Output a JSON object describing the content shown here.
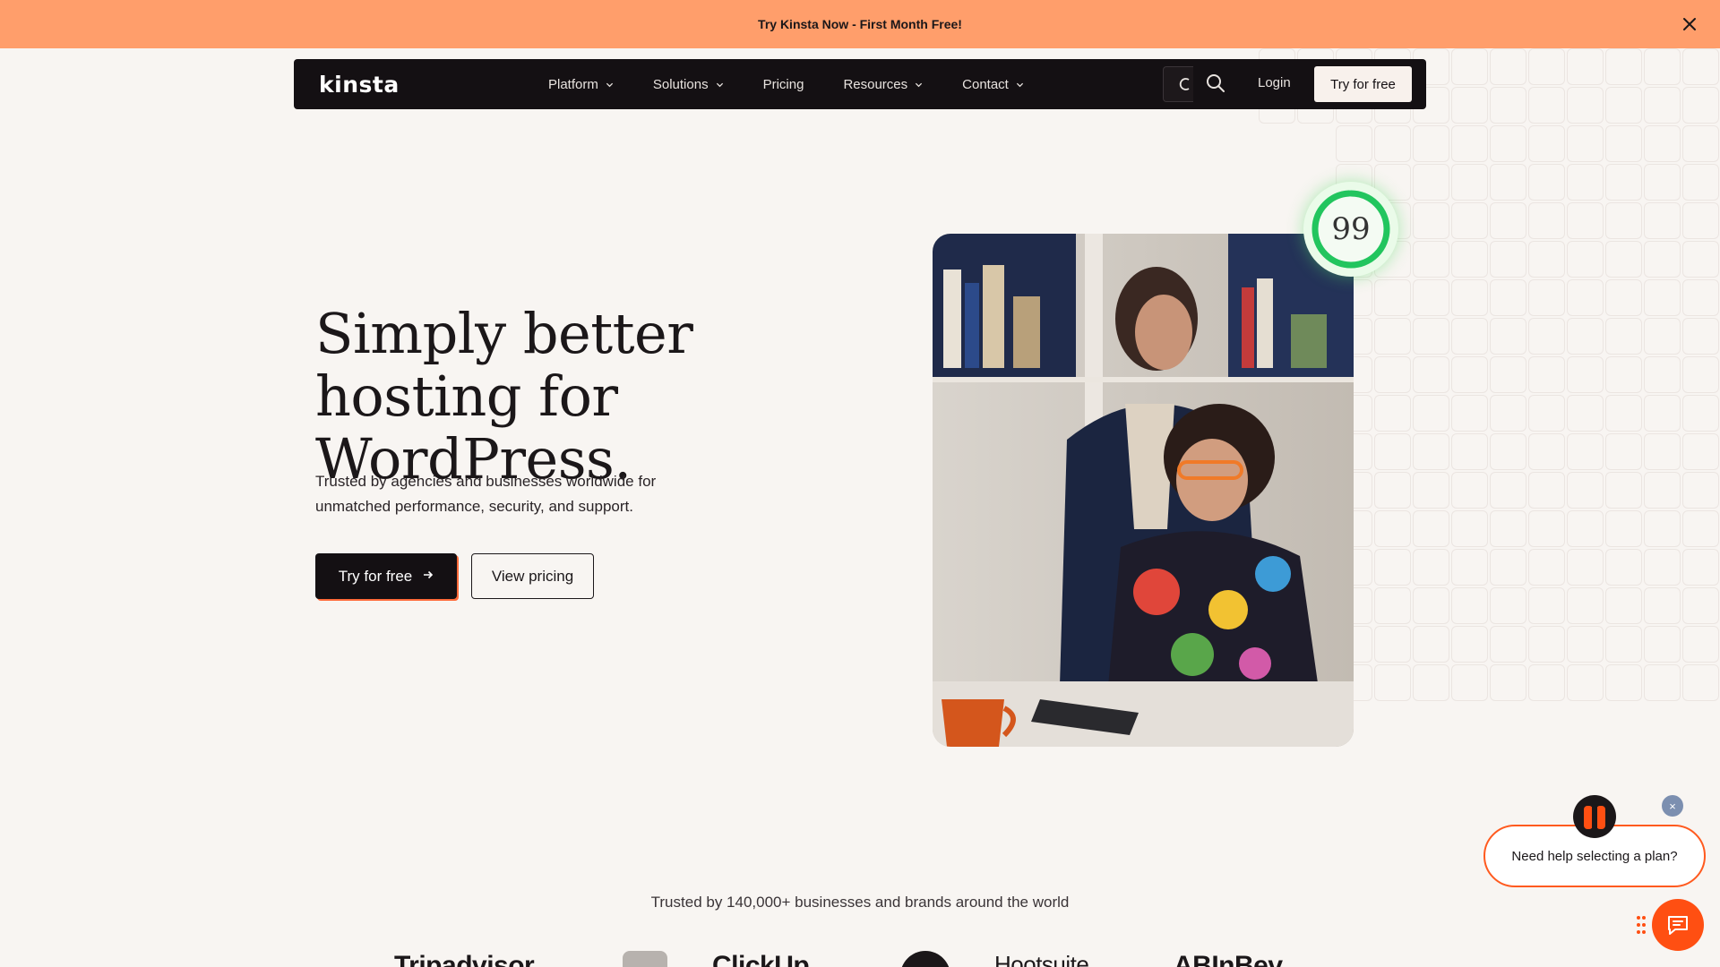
{
  "announcement": {
    "text": "Try Kinsta Now - First Month Free!",
    "close_icon": "close-icon"
  },
  "nav": {
    "logo": "kinsta",
    "items": [
      {
        "label": "Platform",
        "has_dropdown": true
      },
      {
        "label": "Solutions",
        "has_dropdown": true
      },
      {
        "label": "Pricing",
        "has_dropdown": false
      },
      {
        "label": "Resources",
        "has_dropdown": true
      },
      {
        "label": "Contact",
        "has_dropdown": true
      }
    ],
    "login": "Login",
    "cta": "Try for free",
    "search_icon": "search-icon"
  },
  "hero": {
    "title": "Simply better hosting for WordPress.",
    "subtitle": "Trusted by agencies and businesses worldwide for unmatched performance, security, and support.",
    "primary_button": "Try for free",
    "secondary_button": "View pricing",
    "score": "99",
    "score_fraction": 0.99
  },
  "trusted": {
    "text": "Trusted by 140,000+ businesses and brands around the world",
    "logos": [
      "Tripadvisor",
      "ClickUp",
      "Hootsuite",
      "ABInBev"
    ]
  },
  "chat": {
    "prompt": "Need help selecting a plan?",
    "close": "×"
  },
  "colors": {
    "announcement_bg": "#ff9e6b",
    "nav_bg": "#141013",
    "page_bg": "#f8f5f2",
    "accent": "#ff4f12",
    "score_ring": "#22c55e"
  }
}
